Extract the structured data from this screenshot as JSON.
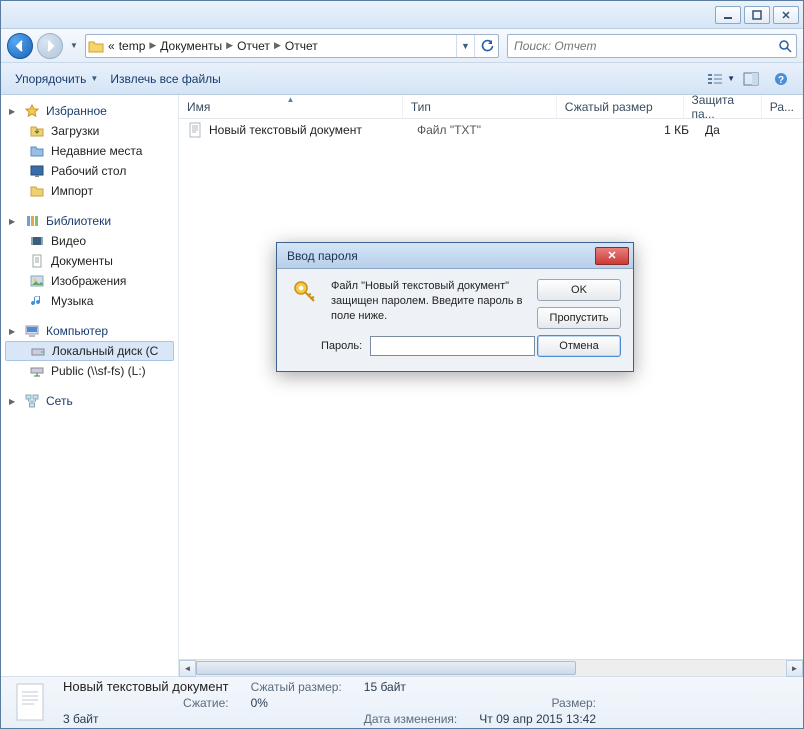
{
  "breadcrumbs": {
    "prefix": "«",
    "items": [
      "temp",
      "Документы",
      "Отчет",
      "Отчет"
    ]
  },
  "search": {
    "placeholder": "Поиск: Отчет"
  },
  "toolbar": {
    "organize": "Упорядочить",
    "extract": "Извлечь все файлы"
  },
  "columns": {
    "name": "Имя",
    "type": "Тип",
    "size": "Сжатый размер",
    "protection": "Защита па...",
    "ratio": "Ра..."
  },
  "files": [
    {
      "name": "Новый текстовый документ",
      "type": "Файл \"TXT\"",
      "size": "1 КБ",
      "protection": "Да"
    }
  ],
  "sidebar": {
    "favorites": {
      "label": "Избранное",
      "items": [
        "Загрузки",
        "Недавние места",
        "Рабочий стол",
        "Импорт"
      ]
    },
    "libraries": {
      "label": "Библиотеки",
      "items": [
        "Видео",
        "Документы",
        "Изображения",
        "Музыка"
      ]
    },
    "computer": {
      "label": "Компьютер",
      "items": [
        "Локальный диск (C",
        "Public (\\\\sf-fs) (L:)"
      ]
    },
    "network": {
      "label": "Сеть"
    }
  },
  "details": {
    "filename": "Новый текстовый документ",
    "size_label": "Сжатый размер:",
    "size_value": "15 байт",
    "raw_label": "Размер:",
    "raw_value": "3 байт",
    "ratio_label": "Сжатие:",
    "ratio_value": "0%",
    "date_label": "Дата изменения:",
    "date_value": "Чт 09 апр 2015 13:42"
  },
  "dialog": {
    "title": "Ввод пароля",
    "message": "Файл \"Новый текстовый документ\" защищен паролем. Введите пароль в поле ниже.",
    "password_label": "Пароль:",
    "ok": "OK",
    "skip": "Пропустить",
    "cancel": "Отмена"
  }
}
